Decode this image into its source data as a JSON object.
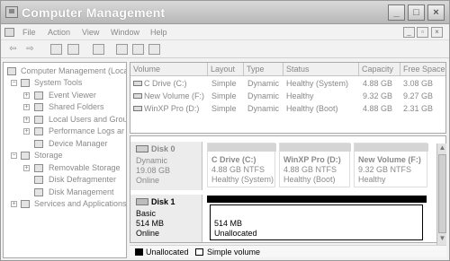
{
  "window": {
    "title": "Computer Management",
    "minimize": "_",
    "maximize": "□",
    "close": "×"
  },
  "menu": {
    "items": [
      "File",
      "Action",
      "View",
      "Window",
      "Help"
    ],
    "mdi_min": "_",
    "mdi_max": "▫",
    "mdi_close": "×"
  },
  "toolbar": {
    "back": "⇦",
    "forward": "⇨",
    "icons": [
      "up-level-icon",
      "show-hide-tree-icon",
      "help-icon",
      "export-icon",
      "properties-icon",
      "console-icon"
    ]
  },
  "tree": {
    "root": "Computer Management (Loca",
    "system_tools": "System Tools",
    "event_viewer": "Event Viewer",
    "shared_folders": "Shared Folders",
    "local_users": "Local Users and Grou",
    "performance_logs": "Performance Logs ar",
    "device_manager": "Device Manager",
    "storage": "Storage",
    "removable_storage": "Removable Storage",
    "disk_defragmenter": "Disk Defragmenter",
    "disk_management": "Disk Management",
    "services": "Services and Applications"
  },
  "volumes": {
    "columns": [
      "Volume",
      "Layout",
      "Type",
      "Status",
      "Capacity",
      "Free Space"
    ],
    "rows": [
      {
        "volume": "C Drive (C:)",
        "layout": "Simple",
        "type": "Dynamic",
        "status": "Healthy (System)",
        "capacity": "4.88 GB",
        "free": "3.08 GB"
      },
      {
        "volume": "New Volume (F:)",
        "layout": "Simple",
        "type": "Dynamic",
        "status": "Healthy",
        "capacity": "9.32 GB",
        "free": "9.27 GB"
      },
      {
        "volume": "WinXP Pro (D:)",
        "layout": "Simple",
        "type": "Dynamic",
        "status": "Healthy (Boot)",
        "capacity": "4.88 GB",
        "free": "2.31 GB"
      }
    ]
  },
  "disks": {
    "disk0": {
      "name": "Disk 0",
      "type": "Dynamic",
      "size": "19.08 GB",
      "status": "Online",
      "partitions": [
        {
          "name": "C Drive  (C:)",
          "size": "4.88 GB NTFS",
          "status": "Healthy (System)"
        },
        {
          "name": "WinXP Pro  (D:)",
          "size": "4.88 GB NTFS",
          "status": "Healthy (Boot)"
        },
        {
          "name": "New Volume  (F:)",
          "size": "9.32 GB NTFS",
          "status": "Healthy"
        }
      ]
    },
    "disk1": {
      "name": "Disk 1",
      "type": "Basic",
      "size": "514 MB",
      "status": "Online",
      "unallocated_size": "514 MB",
      "unallocated_label": "Unallocated"
    }
  },
  "legend": {
    "unallocated": "Unallocated",
    "simple_volume": "Simple volume"
  },
  "colors": {
    "unallocated": "#000000",
    "simple_volume": "#ffffff",
    "title_text": "#ffffff"
  }
}
